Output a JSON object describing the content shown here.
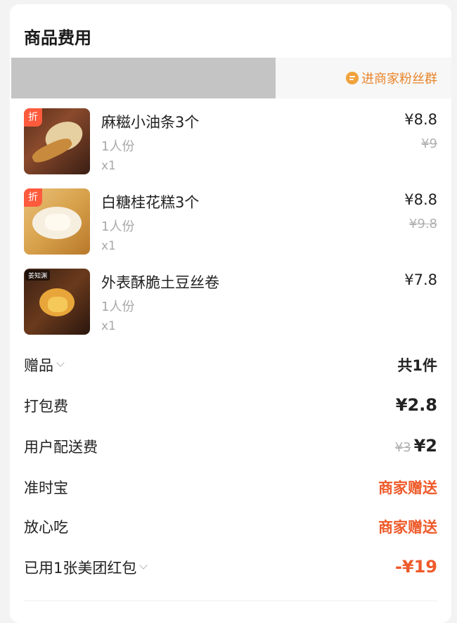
{
  "section": {
    "title": "商品费用"
  },
  "banner": {
    "fan_group_label": "进商家粉丝群"
  },
  "items": [
    {
      "name": "麻糍小油条3个",
      "spec": "1人份",
      "qty": "x1",
      "price": "¥8.8",
      "old_price": "¥9",
      "tag": "折"
    },
    {
      "name": "白糖桂花糕3个",
      "spec": "1人份",
      "qty": "x1",
      "price": "¥8.8",
      "old_price": "¥9.8",
      "tag": "折"
    },
    {
      "name": "外表酥脆土豆丝卷",
      "spec": "1人份",
      "qty": "x1",
      "price": "¥7.8",
      "brand_tag": "姜知渊"
    }
  ],
  "fees": {
    "gift_label": "赠品",
    "gift_value": "共1件",
    "packing_label": "打包费",
    "packing_value": "¥2.8",
    "delivery_label": "用户配送费",
    "delivery_old": "¥3",
    "delivery_value": "¥2",
    "ontime_label": "准时宝",
    "ontime_value": "商家赠送",
    "safe_label": "放心吃",
    "safe_value": "商家赠送",
    "redpack_label": "已用1张美团红包",
    "redpack_value": "-¥19"
  },
  "colors": {
    "accent_orange": "#ee5a2a",
    "fan_orange": "#e8842a",
    "discount_tag": "#ff5a3c"
  },
  "icons": {
    "fan_group": "chat-bubble-icon",
    "expand": "chevron-down-icon"
  }
}
